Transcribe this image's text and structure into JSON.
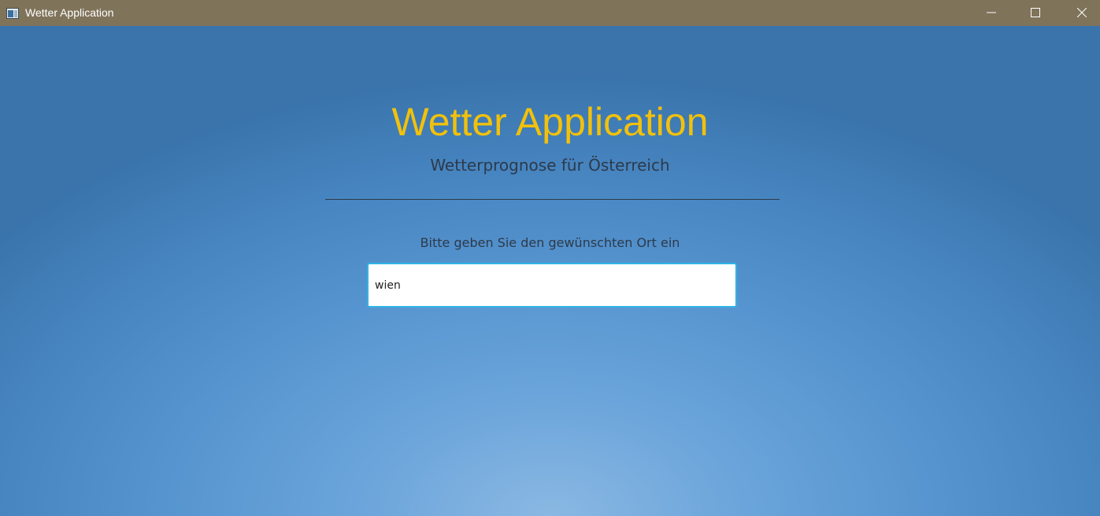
{
  "window": {
    "title": "Wetter Application",
    "controls": [
      "minimize-icon",
      "maximize-icon",
      "close-icon"
    ]
  },
  "app": {
    "title": "Wetter Application",
    "subtitle": "Wetterprognose für Österreich",
    "prompt": "Bitte geben Sie den gewünschten Ort ein"
  },
  "search": {
    "value": "wien",
    "placeholder": ""
  },
  "colors": {
    "titlebar": "#7f735a",
    "title_accent": "#f2c10b",
    "background": "#5694cf",
    "input_focus_border": "#2fb4e6",
    "text": "#2d3a4a"
  }
}
